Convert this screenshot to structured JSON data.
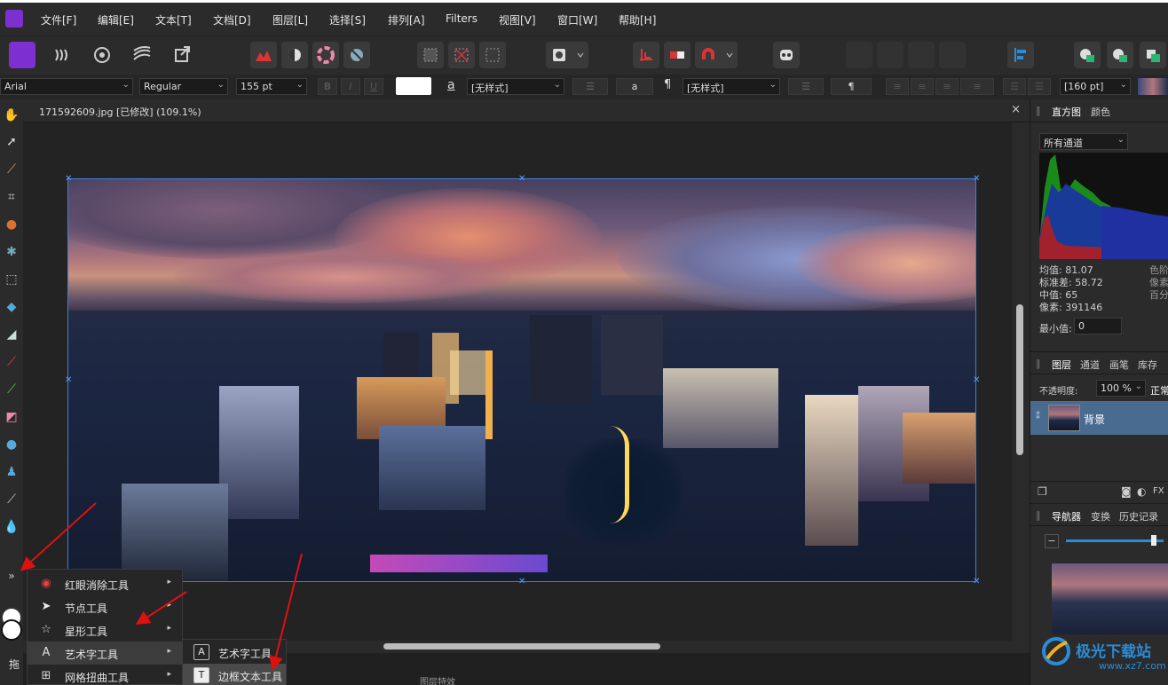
{
  "menubar": {
    "items": [
      "文件[F]",
      "编辑[E]",
      "文本[T]",
      "文档[D]",
      "图层[L]",
      "选择[S]",
      "排列[A]",
      "Filters",
      "视图[V]",
      "窗口[W]",
      "帮助[H]"
    ]
  },
  "context_bar": {
    "font": "Arial",
    "style": "Regular",
    "size": "155 pt",
    "char_style_glyph": "a",
    "char_style": "[无样式]",
    "para_glyph": "a",
    "para_mark": "¶",
    "para_style": "[无样式]",
    "para_mark2": "¶",
    "leading": "[160 pt]"
  },
  "document": {
    "tab_title": "171592609.jpg [已修改] (109.1%)",
    "close_glyph": "×"
  },
  "histogram": {
    "tabs": [
      "直方图",
      "颜色"
    ],
    "channel": "所有通道",
    "mean": "均值: 81.07",
    "std": "标准差: 58.72",
    "median": "中值: 65",
    "pixels": "像素: 391146",
    "extra1": "色阶",
    "extra2": "像素",
    "extra3": "百分",
    "min_label": "最小值:",
    "min_value": "0"
  },
  "layers": {
    "tabs": [
      "图层",
      "通道",
      "画笔",
      "库存"
    ],
    "opacity_label": "不透明度:",
    "opacity": "100 %",
    "blend": "正常",
    "layer_name": "背景",
    "fx": "FX"
  },
  "navigator": {
    "tabs": [
      "导航器",
      "变换",
      "历史记录"
    ]
  },
  "popup_menu": {
    "items": [
      {
        "label": "红眼消除工具",
        "icon": "red-eye-icon"
      },
      {
        "label": "节点工具",
        "icon": "node-icon"
      },
      {
        "label": "星形工具",
        "icon": "star-icon"
      },
      {
        "label": "艺术字工具",
        "icon": "artistic-text-icon"
      },
      {
        "label": "网格扭曲工具",
        "icon": "mesh-warp-icon"
      }
    ],
    "arrow": "▸"
  },
  "submenu": {
    "items": [
      {
        "label": "艺术字工具",
        "icon": "A"
      },
      {
        "label": "边框文本工具",
        "icon": "T"
      }
    ]
  },
  "expand_glyph": "»",
  "bottom_hint": "拖",
  "status_text": "图层特效",
  "watermark": {
    "text": "极光下载站",
    "url": "www.xz7.com"
  }
}
